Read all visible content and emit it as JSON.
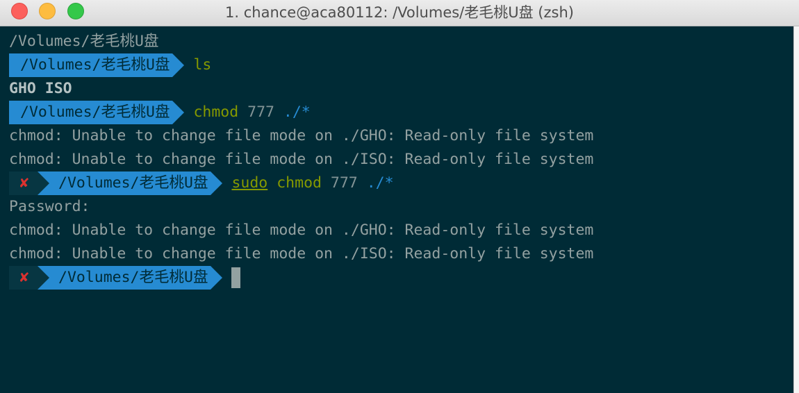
{
  "window": {
    "title": "1. chance@aca80112: /Volumes/老毛桃U盘 (zsh)"
  },
  "colors": {
    "background": "#002b36",
    "prompt_path_bg": "#268bd2",
    "status_bg": "#073642",
    "error_red": "#dc322f",
    "command_green": "#859900"
  },
  "icons": {
    "close": "red-circle",
    "minimize": "yellow-circle",
    "maximize": "green-circle",
    "error_status": "cross-mark-icon"
  },
  "terminal": {
    "lines": {
      "l1": "/Volumes/老毛桃U盘",
      "p1_path": "/Volumes/老毛桃U盘",
      "p1_cmd": "ls",
      "l3": "GHO ISO",
      "p2_path": "/Volumes/老毛桃U盘",
      "p2_cmd": "chmod",
      "p2_arg": " 777 ",
      "p2_glob": "./*",
      "l5": "chmod: Unable to change file mode on ./GHO: Read-only file system",
      "l6": "chmod: Unable to change file mode on ./ISO: Read-only file system",
      "p3_status": "✘",
      "p3_path": "/Volumes/老毛桃U盘",
      "p3_sudo": "sudo",
      "p3_cmd": "chmod",
      "p3_arg": " 777 ",
      "p3_glob": "./*",
      "l8": "Password:",
      "l9": "chmod: Unable to change file mode on ./GHO: Read-only file system",
      "l10": "chmod: Unable to change file mode on ./ISO: Read-only file system",
      "p4_status": "✘",
      "p4_path": "/Volumes/老毛桃U盘"
    }
  }
}
